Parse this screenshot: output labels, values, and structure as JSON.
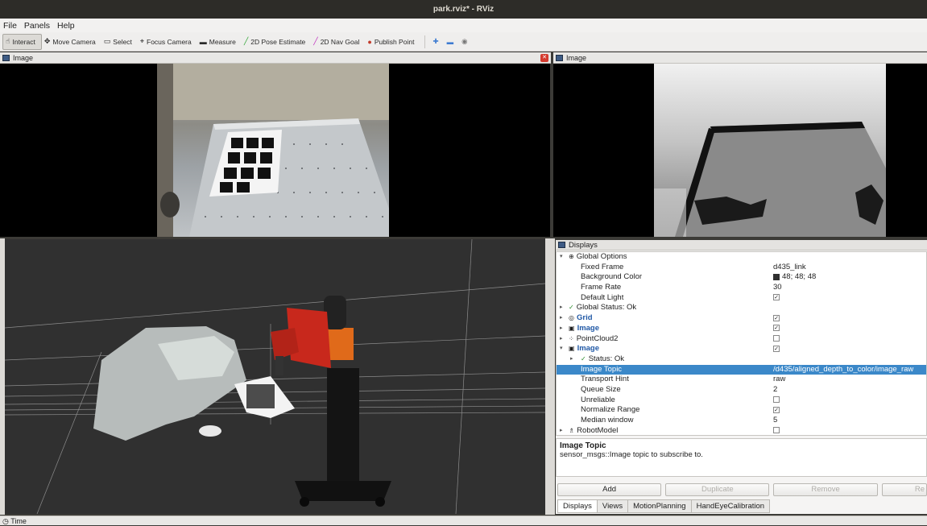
{
  "window": {
    "title": "park.rviz* - RViz"
  },
  "menu": [
    "File",
    "Panels",
    "Help"
  ],
  "toolbar": [
    {
      "label": "Interact",
      "icon": "interact-icon",
      "glyph": "☝",
      "active": true
    },
    {
      "label": "Move Camera",
      "icon": "move-camera-icon",
      "glyph": "✥"
    },
    {
      "label": "Select",
      "icon": "select-icon",
      "glyph": "▭"
    },
    {
      "label": "Focus Camera",
      "icon": "focus-camera-icon",
      "glyph": "⌖"
    },
    {
      "label": "Measure",
      "icon": "measure-icon",
      "glyph": "▬"
    },
    {
      "label": "2D Pose Estimate",
      "icon": "pose-estimate-icon",
      "glyph": "╱",
      "color": "#2fa535"
    },
    {
      "label": "2D Nav Goal",
      "icon": "nav-goal-icon",
      "glyph": "╱",
      "color": "#c02fbf"
    },
    {
      "label": "Publish Point",
      "icon": "publish-point-icon",
      "glyph": "●",
      "color": "#c23a2a"
    }
  ],
  "panels": {
    "image_left": {
      "title": "Image"
    },
    "image_right": {
      "title": "Image"
    },
    "displays": {
      "title": "Displays"
    },
    "time": {
      "title": "Time"
    }
  },
  "tree": [
    {
      "indent": 0,
      "arrow": "▾",
      "icon": "⊕",
      "label": "Global Options",
      "value": ""
    },
    {
      "indent": 1,
      "arrow": "",
      "icon": "",
      "label": "Fixed Frame",
      "value": "d435_link"
    },
    {
      "indent": 1,
      "arrow": "",
      "icon": "",
      "label": "Background Color",
      "value": "48; 48; 48",
      "swatch": "#303030"
    },
    {
      "indent": 1,
      "arrow": "",
      "icon": "",
      "label": "Frame Rate",
      "value": "30"
    },
    {
      "indent": 1,
      "arrow": "",
      "icon": "",
      "label": "Default Light",
      "value": "",
      "check": true
    },
    {
      "indent": 0,
      "arrow": "▸",
      "icon": "✓",
      "label": "Global Status: Ok",
      "value": ""
    },
    {
      "indent": 0,
      "arrow": "▸",
      "icon": "◎",
      "label": "Grid",
      "value": "",
      "check": true,
      "blue": true
    },
    {
      "indent": 0,
      "arrow": "▸",
      "icon": "▣",
      "label": "Image",
      "value": "",
      "check": true,
      "blue": true
    },
    {
      "indent": 0,
      "arrow": "▸",
      "icon": "⁘",
      "label": "PointCloud2",
      "value": "",
      "check": false
    },
    {
      "indent": 0,
      "arrow": "▾",
      "icon": "▣",
      "label": "Image",
      "value": "",
      "check": true,
      "blue": true
    },
    {
      "indent": 1,
      "arrow": "▸",
      "icon": "✓",
      "label": "Status: Ok",
      "value": ""
    },
    {
      "indent": 1,
      "arrow": "",
      "icon": "",
      "label": "Image Topic",
      "value": "/d435/aligned_depth_to_color/image_raw",
      "selected": true
    },
    {
      "indent": 1,
      "arrow": "",
      "icon": "",
      "label": "Transport Hint",
      "value": "raw"
    },
    {
      "indent": 1,
      "arrow": "",
      "icon": "",
      "label": "Queue Size",
      "value": "2"
    },
    {
      "indent": 1,
      "arrow": "",
      "icon": "",
      "label": "Unreliable",
      "value": "",
      "check": false
    },
    {
      "indent": 1,
      "arrow": "",
      "icon": "",
      "label": "Normalize Range",
      "value": "",
      "check": true
    },
    {
      "indent": 1,
      "arrow": "",
      "icon": "",
      "label": "Median window",
      "value": "5"
    },
    {
      "indent": 0,
      "arrow": "▸",
      "icon": "♗",
      "label": "RobotModel",
      "value": "",
      "check": false
    }
  ],
  "description": {
    "title": "Image Topic",
    "text": "sensor_msgs::Image topic to subscribe to."
  },
  "buttons": [
    {
      "label": "Add",
      "enabled": true
    },
    {
      "label": "Duplicate",
      "enabled": false
    },
    {
      "label": "Remove",
      "enabled": false
    },
    {
      "label": "Re",
      "enabled": false
    }
  ],
  "tabs": [
    "Displays",
    "Views",
    "MotionPlanning",
    "HandEyeCalibration"
  ]
}
